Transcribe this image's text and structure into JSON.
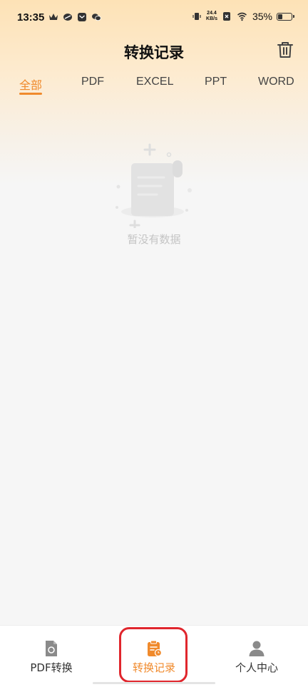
{
  "status_bar": {
    "time": "13:35",
    "net_speed_value": "24.4",
    "net_speed_unit": "KB/s",
    "battery_percent": "35%",
    "battery_level": 0.35
  },
  "header": {
    "title": "转换记录",
    "trash_icon": "trash-icon"
  },
  "tabs": [
    {
      "label": "全部",
      "active": true
    },
    {
      "label": "PDF",
      "active": false
    },
    {
      "label": "EXCEL",
      "active": false
    },
    {
      "label": "PPT",
      "active": false
    },
    {
      "label": "WORD",
      "active": false
    }
  ],
  "empty_state": {
    "message": "暂没有数据",
    "icon": "empty-document-icon"
  },
  "bottom_nav": [
    {
      "label": "PDF转换",
      "icon": "file-convert-icon",
      "active": false
    },
    {
      "label": "转换记录",
      "icon": "clipboard-record-icon",
      "active": true
    },
    {
      "label": "个人中心",
      "icon": "user-icon",
      "active": false
    }
  ],
  "colors": {
    "accent": "#f08a2c",
    "highlight": "#e0262d",
    "muted_text": "#c4c4c4"
  }
}
